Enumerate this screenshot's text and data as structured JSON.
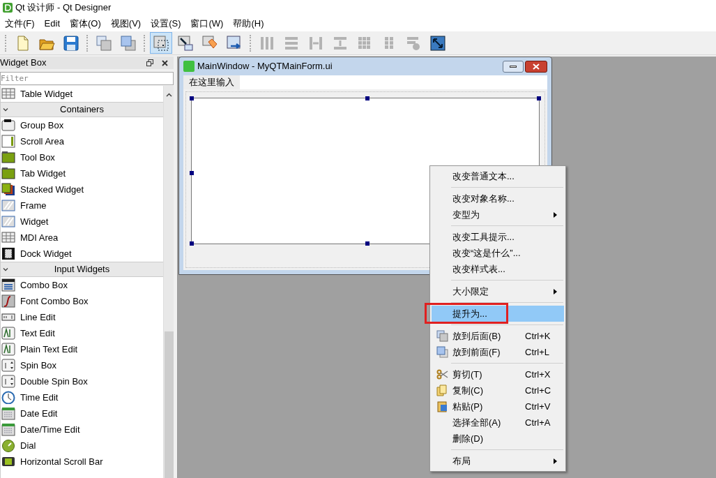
{
  "window": {
    "title": "Qt 设计师 - Qt Designer"
  },
  "menubar": [
    "文件(F)",
    "Edit",
    "窗体(O)",
    "视图(V)",
    "设置(S)",
    "窗口(W)",
    "帮助(H)"
  ],
  "toolbar": [
    [
      {
        "kind": "new",
        "selected": false,
        "disabled": false
      },
      {
        "kind": "open",
        "selected": false,
        "disabled": false
      },
      {
        "kind": "save",
        "selected": false,
        "disabled": false
      }
    ],
    [
      {
        "kind": "back",
        "selected": false,
        "disabled": false
      },
      {
        "kind": "front",
        "selected": false,
        "disabled": false
      }
    ],
    [
      {
        "kind": "widgets",
        "selected": true,
        "disabled": false
      },
      {
        "kind": "signals",
        "selected": false,
        "disabled": false
      },
      {
        "kind": "buddies",
        "selected": false,
        "disabled": false
      },
      {
        "kind": "taborder",
        "selected": false,
        "disabled": false
      }
    ],
    [
      {
        "kind": "hlayout",
        "selected": false,
        "disabled": true
      },
      {
        "kind": "vlayout",
        "selected": false,
        "disabled": true
      },
      {
        "kind": "hsplit",
        "selected": false,
        "disabled": true
      },
      {
        "kind": "vsplit",
        "selected": false,
        "disabled": true
      },
      {
        "kind": "grid",
        "selected": false,
        "disabled": true
      },
      {
        "kind": "form",
        "selected": false,
        "disabled": true
      },
      {
        "kind": "break",
        "selected": false,
        "disabled": true
      },
      {
        "kind": "adjust",
        "selected": false,
        "disabled": false
      }
    ]
  ],
  "widget_box": {
    "title": "Widget Box",
    "filter": {
      "placeholder": "Filter"
    },
    "items": [
      {
        "kind": "item",
        "label": "Table Widget"
      },
      {
        "kind": "category",
        "label": "Containers",
        "expanded": true
      },
      {
        "kind": "item",
        "label": "Group Box"
      },
      {
        "kind": "item",
        "label": "Scroll Area"
      },
      {
        "kind": "item",
        "label": "Tool Box"
      },
      {
        "kind": "item",
        "label": "Tab Widget"
      },
      {
        "kind": "item",
        "label": "Stacked Widget"
      },
      {
        "kind": "item",
        "label": "Frame"
      },
      {
        "kind": "item",
        "label": "Widget"
      },
      {
        "kind": "item",
        "label": "MDI Area"
      },
      {
        "kind": "item",
        "label": "Dock Widget"
      },
      {
        "kind": "category",
        "label": "Input Widgets",
        "expanded": true
      },
      {
        "kind": "item",
        "label": "Combo Box"
      },
      {
        "kind": "item",
        "label": "Font Combo Box"
      },
      {
        "kind": "item",
        "label": "Line Edit"
      },
      {
        "kind": "item",
        "label": "Text Edit"
      },
      {
        "kind": "item",
        "label": "Plain Text Edit"
      },
      {
        "kind": "item",
        "label": "Spin Box"
      },
      {
        "kind": "item",
        "label": "Double Spin Box"
      },
      {
        "kind": "item",
        "label": "Time Edit"
      },
      {
        "kind": "item",
        "label": "Date Edit"
      },
      {
        "kind": "item",
        "label": "Date/Time Edit"
      },
      {
        "kind": "item",
        "label": "Dial"
      },
      {
        "kind": "item",
        "label": "Horizontal Scroll Bar"
      }
    ]
  },
  "form": {
    "title": "MainWindow - MyQTMainForm.ui",
    "menu_placeholder": "在这里输入",
    "central_selected": true
  },
  "context_menu": [
    {
      "kind": "action",
      "label": "改变普通文本...",
      "highlighted": false
    },
    {
      "kind": "separator"
    },
    {
      "kind": "action",
      "label": "改变对象名称...",
      "highlighted": false
    },
    {
      "kind": "action",
      "label": "变型为",
      "submenu": true,
      "highlighted": false
    },
    {
      "kind": "separator"
    },
    {
      "kind": "action",
      "label": "改变工具提示...",
      "highlighted": false
    },
    {
      "kind": "action",
      "label": "改变“这是什么”...",
      "highlighted": false
    },
    {
      "kind": "action",
      "label": "改变样式表...",
      "highlighted": false
    },
    {
      "kind": "separator"
    },
    {
      "kind": "action",
      "label": "大小限定",
      "submenu": true,
      "highlighted": false
    },
    {
      "kind": "separator"
    },
    {
      "kind": "action",
      "label": "提升为...",
      "highlighted": true,
      "annotated": true
    },
    {
      "kind": "separator"
    },
    {
      "kind": "action",
      "label": "放到后面(B)",
      "shortcut": "Ctrl+K",
      "highlighted": false
    },
    {
      "kind": "action",
      "label": "放到前面(F)",
      "shortcut": "Ctrl+L",
      "highlighted": false
    },
    {
      "kind": "separator"
    },
    {
      "kind": "action",
      "label": "剪切(T)",
      "shortcut": "Ctrl+X",
      "highlighted": false
    },
    {
      "kind": "action",
      "label": "复制(C)",
      "shortcut": "Ctrl+C",
      "highlighted": false
    },
    {
      "kind": "action",
      "label": "粘贴(P)",
      "shortcut": "Ctrl+V",
      "highlighted": false
    },
    {
      "kind": "action",
      "label": "选择全部(A)",
      "shortcut": "Ctrl+A",
      "highlighted": false
    },
    {
      "kind": "action",
      "label": "删除(D)",
      "highlighted": false
    },
    {
      "kind": "separator"
    },
    {
      "kind": "action",
      "label": "布局",
      "submenu": true,
      "highlighted": false
    }
  ]
}
